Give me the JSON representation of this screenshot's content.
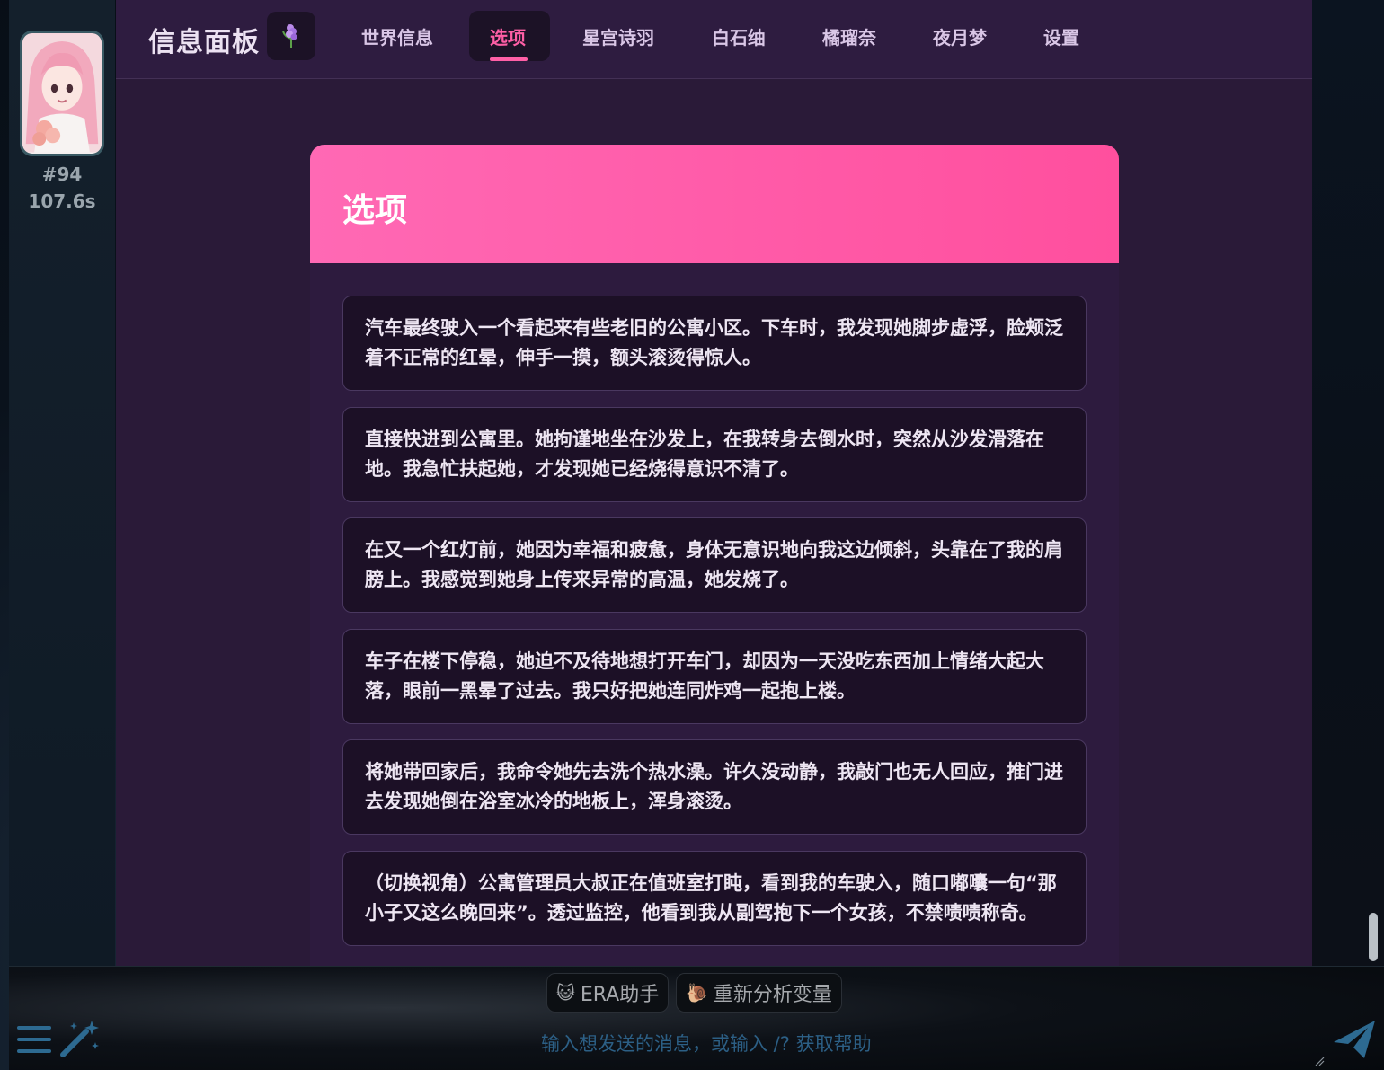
{
  "message": {
    "id": "#94",
    "time": "107.6s"
  },
  "header": {
    "title": "信息面板",
    "tabs": [
      {
        "label": "世界信息"
      },
      {
        "label": "选项"
      },
      {
        "label": "星宫诗羽"
      },
      {
        "label": "白石䌷"
      },
      {
        "label": "橘瑠奈"
      },
      {
        "label": "夜月梦"
      },
      {
        "label": "设置"
      }
    ],
    "active_tab": "选项"
  },
  "card": {
    "title": "选项",
    "options": [
      "汽车最终驶入一个看起来有些老旧的公寓小区。下车时，我发现她脚步虚浮，脸颊泛着不正常的红晕，伸手一摸，额头滚烫得惊人。",
      "直接快进到公寓里。她拘谨地坐在沙发上，在我转身去倒水时，突然从沙发滑落在地。我急忙扶起她，才发现她已经烧得意识不清了。",
      "在又一个红灯前，她因为幸福和疲惫，身体无意识地向我这边倾斜，头靠在了我的肩膀上。我感觉到她身上传来异常的高温，她发烧了。",
      "车子在楼下停稳，她迫不及待地想打开车门，却因为一天没吃东西加上情绪大起大落，眼前一黑晕了过去。我只好把她连同炸鸡一起抱上楼。",
      "将她带回家后，我命令她先去洗个热水澡。许久没动静，我敲门也无人回应，推门进去发现她倒在浴室冰冷的地板上，浑身滚烫。",
      "（切换视角）公寓管理员大叔正在值班室打盹，看到我的车驶入，随口嘟囔一句“那小子又这么晚回来”。透过监控，他看到我从副驾抱下一个女孩，不禁啧啧称奇。"
    ]
  },
  "input_bar": {
    "chips": [
      {
        "icon": "cat-face-icon",
        "label": "ERA助手"
      },
      {
        "icon": "snail-icon",
        "label": "重新分析变量"
      }
    ],
    "placeholder": "输入想发送的消息，或输入 /? 获取帮助"
  },
  "colors": {
    "accent": "#ff5fa6",
    "panel_bg": "#2a1a38",
    "card_header": "#ff5fa6",
    "option_bg": "#1c1026"
  }
}
